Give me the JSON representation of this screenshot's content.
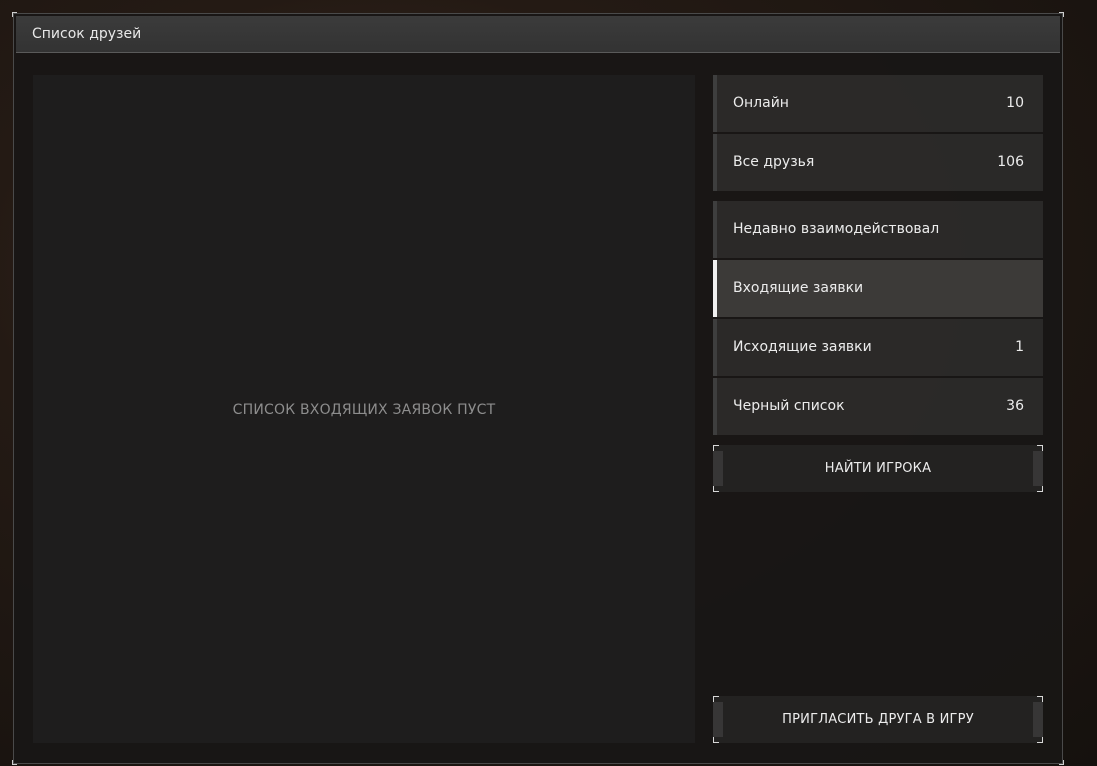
{
  "window": {
    "title": "Список друзей"
  },
  "content": {
    "empty_message": "СПИСОК ВХОДЯЩИХ ЗАЯВОК ПУСТ"
  },
  "sidebar": {
    "top_items": [
      {
        "label": "Онлайн",
        "count": "10"
      },
      {
        "label": "Все друзья",
        "count": "106"
      }
    ],
    "items": [
      {
        "label": "Недавно взаимодействовал",
        "count": ""
      },
      {
        "label": "Входящие заявки",
        "count": "",
        "active": true
      },
      {
        "label": "Исходящие заявки",
        "count": "1"
      },
      {
        "label": "Черный список",
        "count": "36"
      }
    ],
    "find_player_label": "НАЙТИ ИГРОКА",
    "invite_friend_label": "ПРИГЛАСИТЬ ДРУГА В ИГРУ"
  }
}
